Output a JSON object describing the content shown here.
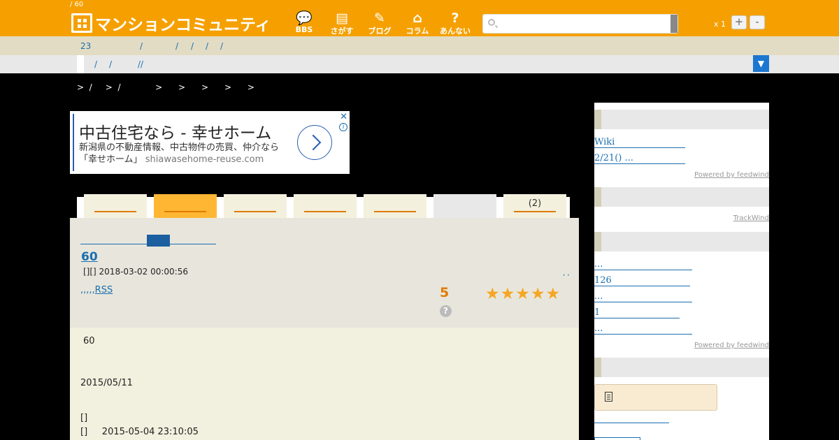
{
  "header": {
    "crumb": "/ 60",
    "logo": "マンションコミュニティ",
    "nav": [
      {
        "label": "BBS",
        "icon": "speech-bubble-icon"
      },
      {
        "label": "さがす",
        "icon": "building-icon"
      },
      {
        "label": "ブログ",
        "icon": "pen-icon"
      },
      {
        "label": "コラム",
        "icon": "house-icon"
      },
      {
        "label": "あんない",
        "icon": "question-icon"
      }
    ],
    "search": {
      "placeholder": "",
      "value": ""
    },
    "zoom": {
      "label": "x 1",
      "plus": "+",
      "minus": "-"
    }
  },
  "subnav1": [
    "23",
    "/",
    "/",
    "/",
    "/",
    "/"
  ],
  "subnav2": [
    "/",
    "/",
    "//"
  ],
  "subnav2_toggle": "▼",
  "breadcrumb": ">  /     >  /             >      >      >      >      >",
  "ad": {
    "title": "中古住宅なら - 幸せホーム",
    "desc": "新潟県の不動産情報、中古物件の売買、仲介なら「幸せホーム」",
    "url": "shiawasehome-reuse.com",
    "close": "✕",
    "info": "i"
  },
  "tabs": [
    {
      "label": ""
    },
    {
      "label": ""
    },
    {
      "label": ""
    },
    {
      "label": ""
    },
    {
      "label": ""
    },
    {
      "label": ""
    },
    {
      "label": "(2)"
    }
  ],
  "post": {
    "title": "60",
    "meta": "[][] 2018-03-02 00:00:56",
    "links_prefix": ",,,,,",
    "rss": "RSS",
    "dots": ", ,",
    "score": "5",
    "rating": 5,
    "help": "?"
  },
  "body": {
    "line1": "60",
    "line2": "2015/05/11",
    "line3": "[]",
    "line4": "[]     2015-05-04 23:10:05"
  },
  "sidebar": {
    "links1": [
      "Wiki",
      "2/21() ..."
    ],
    "powered1": "Powered by feedwind",
    "powered2": "TrackWind",
    "links2": [
      "...",
      "126",
      "...",
      "1",
      "..."
    ],
    "powered3": "Powered by feedwind"
  }
}
